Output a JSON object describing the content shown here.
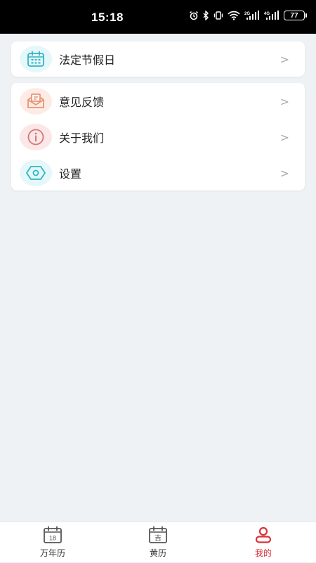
{
  "status_bar": {
    "time": "15:18",
    "battery": "77",
    "signal_1": "2G",
    "signal_2": "4G"
  },
  "menu": {
    "group1": [
      {
        "label": "法定节假日",
        "icon": "calendar-icon",
        "icon_color": "#2fb5c6",
        "icon_bg": "#e6f7f9"
      }
    ],
    "group2": [
      {
        "label": "意见反馈",
        "icon": "mail-icon",
        "icon_color": "#e89373",
        "icon_bg": "#fdece6"
      },
      {
        "label": "关于我们",
        "icon": "info-icon",
        "icon_color": "#d4777a",
        "icon_bg": "#fbe7e8"
      },
      {
        "label": "设置",
        "icon": "settings-icon",
        "icon_color": "#2fb5c6",
        "icon_bg": "#e6f7f9"
      }
    ],
    "chevron": ">"
  },
  "tabbar": {
    "tabs": [
      {
        "label": "万年历",
        "icon": "calendar-18-icon",
        "icon_text": "18",
        "active": false
      },
      {
        "label": "黄历",
        "icon": "almanac-icon",
        "icon_text": "吉",
        "active": false
      },
      {
        "label": "我的",
        "icon": "user-icon",
        "active": true
      }
    ],
    "active_color": "#d9323a"
  }
}
